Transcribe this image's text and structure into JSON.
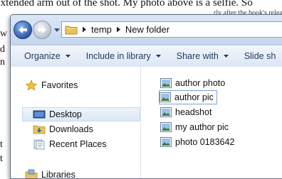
{
  "background_doc": {
    "lines": [
      "extended arm out of the shot. My photo above is a selfie. So",
      "rly after the book's release but it would be used,",
      "w",
      "d",
      "n",
      "t",
      "t"
    ]
  },
  "window": {
    "breadcrumbs": [
      "temp",
      "New folder"
    ],
    "toolbar": [
      "Organize",
      "Include in library",
      "Share with",
      "Slide sh"
    ],
    "nav": {
      "favorites": "Favorites",
      "desktop": "Desktop",
      "downloads": "Downloads",
      "recent": "Recent Places",
      "libraries": "Libraries"
    },
    "files": [
      "author photo",
      "author pic",
      "headshot",
      "my author pic",
      "photo 0183642"
    ]
  },
  "colors": {
    "selection": "#dbe8f6",
    "toolbar_text": "#1e395b",
    "window_frame": "#cfdced"
  }
}
